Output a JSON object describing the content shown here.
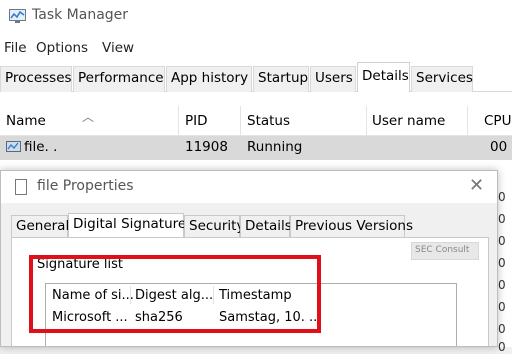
{
  "app": {
    "title": "Task Manager"
  },
  "menu": [
    "File",
    "Options",
    "View"
  ],
  "tabs": [
    "Processes",
    "Performance",
    "App history",
    "Startup",
    "Users",
    "Details",
    "Services"
  ],
  "grid": {
    "columns": [
      "Name",
      "PID",
      "Status",
      "User name",
      "CPU"
    ],
    "selected_row": {
      "name": "file. .",
      "pid": "11908",
      "status": "Running",
      "user": "",
      "cpu": "00"
    }
  },
  "strip_values": [
    "0",
    "0",
    "0",
    "0",
    "0",
    "0",
    "0",
    "0"
  ],
  "dialog": {
    "title": "file Properties",
    "close_glyph": "✕",
    "tabs": [
      "General",
      "Digital Signatures",
      "Security",
      "Details",
      "Previous Versions"
    ],
    "logo_text": "SEC Consult",
    "signature_list_label": "Signature list",
    "list_columns": [
      "Name of si...",
      "Digest alg...",
      "Timestamp"
    ],
    "list_rows": [
      {
        "name": "Microsoft ...",
        "digest": "sha256",
        "timestamp": "Samstag, 10. ..."
      }
    ]
  },
  "colors": {
    "highlight": "#e0101a",
    "selected_row": "#d9d9d9"
  }
}
